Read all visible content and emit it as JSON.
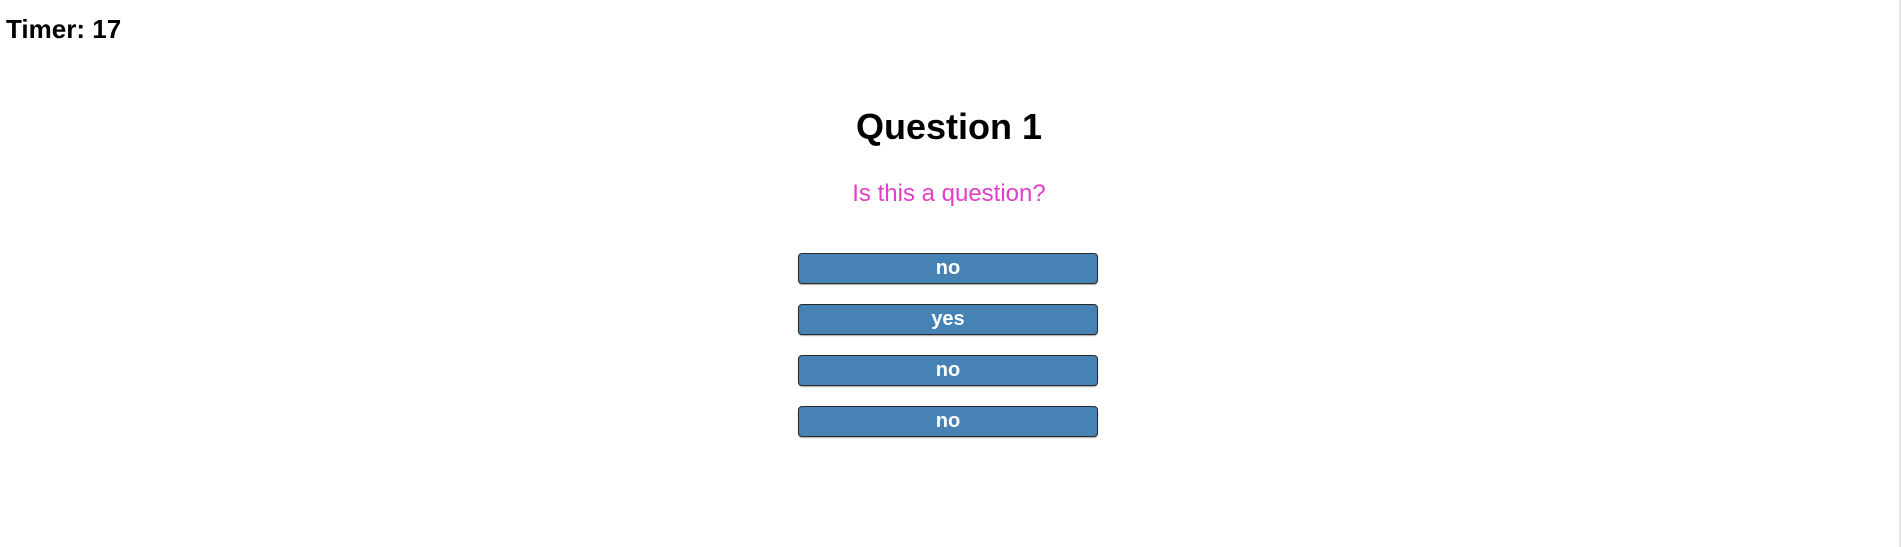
{
  "timer": {
    "label": "Timer:",
    "value": "17"
  },
  "question": {
    "title": "Question 1",
    "text": "Is this a question?"
  },
  "answers": [
    {
      "label": "no"
    },
    {
      "label": "yes"
    },
    {
      "label": "no"
    },
    {
      "label": "no"
    }
  ],
  "colors": {
    "question_text": "#e040c8",
    "button_bg": "#4682b4",
    "button_text": "#ffffff"
  }
}
